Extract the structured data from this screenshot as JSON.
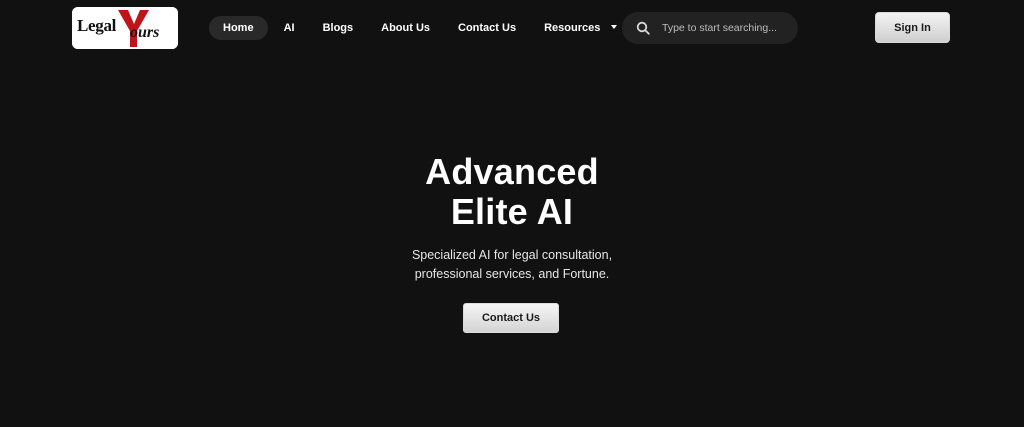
{
  "brand": {
    "logo_text_1": "Legal",
    "logo_text_2": "Y",
    "logo_text_3": "ours",
    "logo_accent": "#c0141b"
  },
  "nav": {
    "items": [
      {
        "label": "Home",
        "active": true
      },
      {
        "label": "AI"
      },
      {
        "label": "Blogs"
      },
      {
        "label": "About Us"
      },
      {
        "label": "Contact Us"
      },
      {
        "label": "Resources",
        "has_dropdown": true
      }
    ]
  },
  "search": {
    "placeholder": "Type to start searching...",
    "icon": "search-icon"
  },
  "auth": {
    "signin_label": "Sign In"
  },
  "hero": {
    "title_line1": "Advanced",
    "title_line2": "Elite AI",
    "subtitle_line1": "Specialized AI for legal consultation,",
    "subtitle_line2": "professional services, and Fortune.",
    "cta_label": "Contact Us"
  },
  "colors": {
    "background": "#121112",
    "button_light": "#e6e6e6",
    "nav_active": "#2a292a",
    "search_bg": "#232223"
  }
}
